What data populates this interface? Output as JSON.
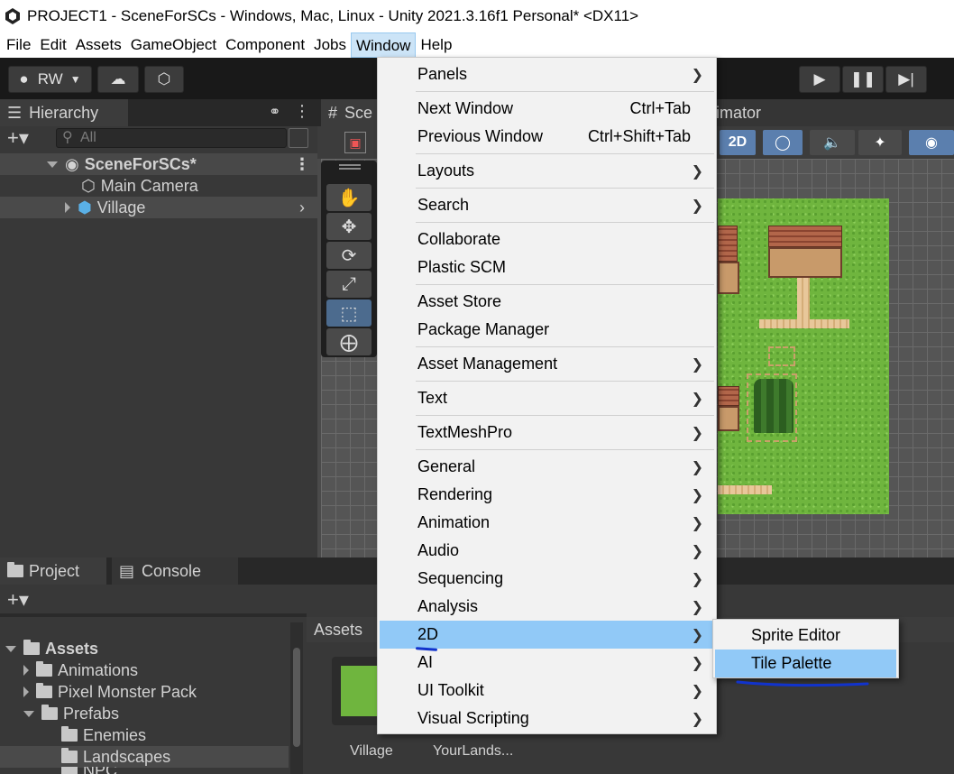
{
  "window": {
    "title": "PROJECT1 - SceneForSCs - Windows, Mac, Linux - Unity 2021.3.16f1 Personal* <DX11>"
  },
  "menubar": {
    "items": [
      "File",
      "Edit",
      "Assets",
      "GameObject",
      "Component",
      "Jobs",
      "Window",
      "Help"
    ],
    "active": "Window"
  },
  "toolbar": {
    "account_label": "RW"
  },
  "hierarchy": {
    "tab_label": "Hierarchy",
    "search_placeholder": "All",
    "scene_name": "SceneForSCs*",
    "items": [
      "Main Camera",
      "Village"
    ]
  },
  "scene": {
    "tab_label": "Sce",
    "animator_tab_label": "imator",
    "mode_2d_label": "2D"
  },
  "project": {
    "tab_label": "Project",
    "console_tab_label": "Console",
    "breadcrumb": "Assets",
    "tree": [
      {
        "label": "Assets",
        "expanded": true
      },
      {
        "label": "Animations"
      },
      {
        "label": "Pixel Monster Pack"
      },
      {
        "label": "Prefabs",
        "expanded": true
      },
      {
        "label": "Enemies"
      },
      {
        "label": "Landscapes"
      },
      {
        "label": "NPC"
      }
    ],
    "assets": [
      "Village",
      "YourLands..."
    ]
  },
  "window_menu": {
    "groups": [
      [
        {
          "label": "Panels",
          "submenu": true
        }
      ],
      [
        {
          "label": "Next Window",
          "shortcut": "Ctrl+Tab"
        },
        {
          "label": "Previous Window",
          "shortcut": "Ctrl+Shift+Tab"
        }
      ],
      [
        {
          "label": "Layouts",
          "submenu": true
        }
      ],
      [
        {
          "label": "Search",
          "submenu": true
        }
      ],
      [
        {
          "label": "Collaborate"
        },
        {
          "label": "Plastic SCM"
        }
      ],
      [
        {
          "label": "Asset Store"
        },
        {
          "label": "Package Manager"
        }
      ],
      [
        {
          "label": "Asset Management",
          "submenu": true
        }
      ],
      [
        {
          "label": "Text",
          "submenu": true
        }
      ],
      [
        {
          "label": "TextMeshPro",
          "submenu": true
        }
      ],
      [
        {
          "label": "General",
          "submenu": true
        },
        {
          "label": "Rendering",
          "submenu": true
        },
        {
          "label": "Animation",
          "submenu": true
        },
        {
          "label": "Audio",
          "submenu": true
        },
        {
          "label": "Sequencing",
          "submenu": true
        },
        {
          "label": "Analysis",
          "submenu": true
        },
        {
          "label": "2D",
          "submenu": true,
          "highlighted": true
        },
        {
          "label": "AI",
          "submenu": true
        },
        {
          "label": "UI Toolkit",
          "submenu": true
        },
        {
          "label": "Visual Scripting",
          "submenu": true
        }
      ]
    ]
  },
  "submenu_2d": {
    "items": [
      {
        "label": "Sprite Editor"
      },
      {
        "label": "Tile Palette",
        "highlighted": true
      }
    ]
  },
  "colors": {
    "highlight": "#91c9f7",
    "annotation": "#1133cc"
  }
}
